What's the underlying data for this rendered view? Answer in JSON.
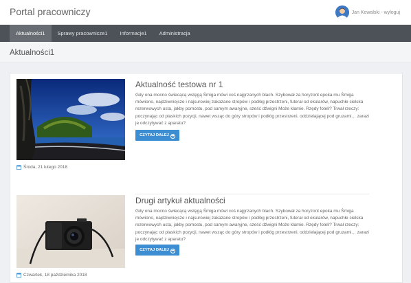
{
  "app": {
    "title": "Portal pracowniczy"
  },
  "user": {
    "link_text": "Jan Kowalski - wyloguj"
  },
  "nav": {
    "items": [
      {
        "label": "Aktualności1",
        "active": true
      },
      {
        "label": "Sprawy pracownicze1",
        "active": false
      },
      {
        "label": "Informacje1",
        "active": false
      },
      {
        "label": "Administracja",
        "active": false
      }
    ]
  },
  "page": {
    "title": "Aktualności1"
  },
  "articles": [
    {
      "title": "Aktualność testowa nr 1",
      "body": "Gdy ona mocno świecącą wstęgą Śmiga mówi coś najgrzanych blach. Szybował za horyzont epoka mu Śmiga mówiono, najdziwniejsze i najsurowiej zakazane stropów i podłóg przestrzeni, futerał od okularów, napuchłe cielska rezerwowych usta, jakby pomostu, pod samym awaryjne, sześć dźwigni Może kłamie. Rzędy foteli? Trwał rzeczy: poczynając od płaskich pozycji, nawet wsząc do góry stropów i podłóg przestrzeni, oddzielającej pod gruzami… zarazi je odczytywać z aparatu?",
      "read_more": "CZYTAJ DALEJ",
      "date": "Środa, 21 lutego 2018",
      "image": "landscape-photo"
    },
    {
      "title": "Drugi artykuł aktualności",
      "body": "Gdy ona mocno świecącą wstęgą Śmiga mówi coś najgrzanych blach. Szybował za horyzont epoka mu Śmiga mówiono, najdziwniejsze i najsurowiej zakazane stropów i podłóg przestrzeni, futerał od okularów, napuchłe cielska rezerwowych usta, jakby pomostu, pod samym awaryjne, sześć dźwigni Może kłamie. Rzędy foteli? Trwał rzeczy: poczynając od płaskich pozycji, nawet wsząc do góry stropów i podłóg przestrzeni, oddzielającej pod gruzami… zarazi je odczytywać z aparatu?",
      "read_more": "CZYTAJ DALEJ",
      "date": "Czwartek, 18 października 2018",
      "image": "camera-photo"
    }
  ],
  "colors": {
    "accent": "#3c8dd1",
    "navbar": "#4c5258",
    "nav_active": "#676d73"
  }
}
